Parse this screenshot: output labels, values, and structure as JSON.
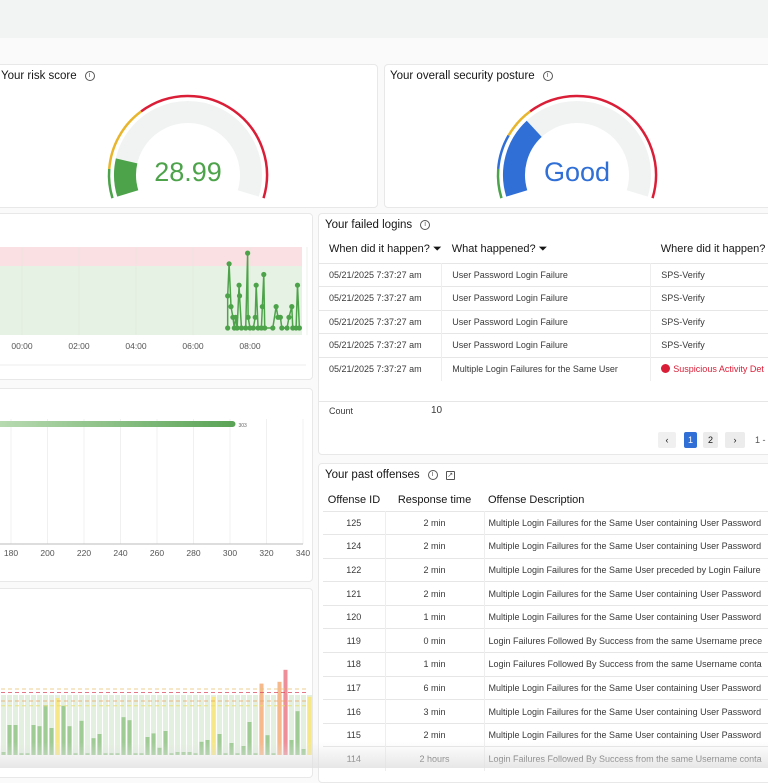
{
  "risk_card": {
    "title": "Your risk score",
    "value": "28.99",
    "fill_fraction": 0.14,
    "value_color": "#4da34a",
    "fill_color": "#4da34a",
    "segments": [
      {
        "to": 0.1,
        "color": "#4da34a"
      },
      {
        "to": 0.33,
        "color": "#e8b52c"
      },
      {
        "to": 1,
        "color": "#da1e37"
      }
    ]
  },
  "posture_card": {
    "title": "Your overall security posture",
    "value": "Good",
    "fill_fraction": 0.3,
    "value_color": "#2f6fd6",
    "fill_color": "#2f6fd6",
    "segments": [
      {
        "to": 0.1,
        "color": "#4da34a"
      },
      {
        "to": 0.22,
        "color": "#2f6fd6"
      },
      {
        "to": 0.33,
        "color": "#e8b52c"
      },
      {
        "to": 1,
        "color": "#da1e37"
      }
    ]
  },
  "chart_data": [
    {
      "type": "line",
      "x_ticks": [
        "00:00",
        "02:00",
        "04:00",
        "06:00",
        "08:00"
      ],
      "grid": true,
      "color": "#4da34a",
      "bands": [
        {
          "name": "high",
          "color": "#fbe0e3"
        },
        {
          "name": "normal",
          "color": "#e6f2e3"
        }
      ],
      "points": [
        [
          "07:13",
          0
        ],
        [
          "07:13",
          3
        ],
        [
          "07:16",
          6
        ],
        [
          "07:20",
          2
        ],
        [
          "07:24",
          1
        ],
        [
          "07:27",
          0
        ],
        [
          "07:30",
          1
        ],
        [
          "07:33",
          0
        ],
        [
          "07:37",
          4
        ],
        [
          "07:38",
          3
        ],
        [
          "07:42",
          0
        ],
        [
          "07:51",
          0
        ],
        [
          "07:55",
          7
        ],
        [
          "07:56",
          1
        ],
        [
          "08:00",
          0
        ],
        [
          "08:07",
          0
        ],
        [
          "08:11",
          1
        ],
        [
          "08:13",
          4
        ],
        [
          "08:17",
          0
        ],
        [
          "08:24",
          0
        ],
        [
          "08:26",
          2
        ],
        [
          "08:29",
          5
        ],
        [
          "08:31",
          0
        ],
        [
          "08:48",
          0
        ],
        [
          "08:55",
          2
        ],
        [
          "08:59",
          1
        ],
        [
          "09:04",
          1
        ],
        [
          "09:07",
          0
        ],
        [
          "09:18",
          0
        ],
        [
          "09:22",
          1
        ],
        [
          "09:28",
          2
        ],
        [
          "09:30",
          0
        ],
        [
          "09:37",
          0
        ],
        [
          "09:40",
          4
        ],
        [
          "09:44",
          0
        ]
      ]
    },
    {
      "type": "bar",
      "orientation": "horizontal",
      "values": [
        303
      ],
      "data_labels": [
        "303"
      ],
      "x_ticks": [
        "180",
        "200",
        "220",
        "240",
        "260",
        "280",
        "300",
        "320",
        "340"
      ],
      "xlim": [
        180,
        340
      ],
      "color": "#5aa356"
    },
    {
      "type": "bar",
      "values": [
        5,
        50,
        50,
        3,
        3,
        50,
        48,
        83,
        45,
        95,
        82,
        48,
        3,
        57,
        3,
        28,
        35,
        3,
        3,
        3,
        63,
        58,
        3,
        3,
        30,
        36,
        12,
        40,
        3,
        5,
        5,
        5,
        3,
        22,
        25,
        97,
        35,
        3,
        20,
        3,
        15,
        55,
        3,
        119,
        33,
        3,
        122,
        142,
        25,
        73,
        10,
        97
      ],
      "levels": [
        "g",
        "g",
        "g",
        "g",
        "g",
        "g",
        "g",
        "g",
        "g",
        "y",
        "g",
        "g",
        "g",
        "g",
        "g",
        "g",
        "g",
        "g",
        "g",
        "g",
        "g",
        "g",
        "g",
        "g",
        "g",
        "g",
        "g",
        "g",
        "g",
        "g",
        "g",
        "g",
        "g",
        "g",
        "g",
        "y",
        "g",
        "g",
        "g",
        "g",
        "g",
        "g",
        "g",
        "o",
        "g",
        "g",
        "o",
        "r",
        "g",
        "g",
        "g",
        "y"
      ],
      "colors": {
        "g": "#9fcb95",
        "y": "#f6e889",
        "o": "#f5b98c",
        "r": "#ee8e98"
      },
      "thresholds": [
        {
          "value": 110,
          "color": "#e8c070"
        },
        {
          "value": 104,
          "color": "#d9485f"
        },
        {
          "value": 90,
          "color": "#e8a25c"
        },
        {
          "value": 82,
          "color": "#e8de70"
        }
      ]
    }
  ],
  "failed_logins": {
    "title": "Your failed logins",
    "columns": [
      "When did it happen?",
      "What happened?",
      "Where did it happen?"
    ],
    "rows": [
      [
        "05/21/2025 7:37:27 am",
        "User Password Login Failure",
        "SPS-Verify"
      ],
      [
        "05/21/2025 7:37:27 am",
        "User Password Login Failure",
        "SPS-Verify"
      ],
      [
        "05/21/2025 7:37:27 am",
        "User Password Login Failure",
        "SPS-Verify"
      ],
      [
        "05/21/2025 7:37:27 am",
        "User Password Login Failure",
        "SPS-Verify"
      ],
      [
        "05/21/2025 7:37:27 am",
        "Multiple Login Failures for the Same User",
        "Suspicious Activity Det"
      ]
    ],
    "alert_color": "#da1e37",
    "count_label": "Count",
    "count_value": "10",
    "pagination": {
      "prev": "‹",
      "pages": [
        "1",
        "2"
      ],
      "current": "1",
      "next": "›",
      "range": "1 -"
    }
  },
  "past_offenses": {
    "title": "Your past offenses",
    "columns": [
      "Offense ID",
      "Response time",
      "Offense Description"
    ],
    "rows": [
      [
        "125",
        "2 min",
        "Multiple Login Failures for the Same User containing User Password"
      ],
      [
        "124",
        "2 min",
        "Multiple Login Failures for the Same User containing User Password"
      ],
      [
        "122",
        "2 min",
        "Multiple Login Failures for the Same User preceded by Login Failure"
      ],
      [
        "121",
        "2 min",
        "Multiple Login Failures for the Same User containing User Password"
      ],
      [
        "120",
        "1 min",
        "Multiple Login Failures for the Same User containing User Password"
      ],
      [
        "119",
        "0 min",
        "Login Failures Followed By Success from the same Username prece"
      ],
      [
        "118",
        "1 min",
        "Login Failures Followed By Success from the same Username conta"
      ],
      [
        "117",
        "6 min",
        "Multiple Login Failures for the Same User containing User Password"
      ],
      [
        "116",
        "3 min",
        "Multiple Login Failures for the Same User containing User Password"
      ],
      [
        "115",
        "2 min",
        "Multiple Login Failures for the Same User containing User Password"
      ],
      [
        "114",
        "2 hours",
        "Login Failures Followed By Success from the same Username conta"
      ]
    ]
  }
}
